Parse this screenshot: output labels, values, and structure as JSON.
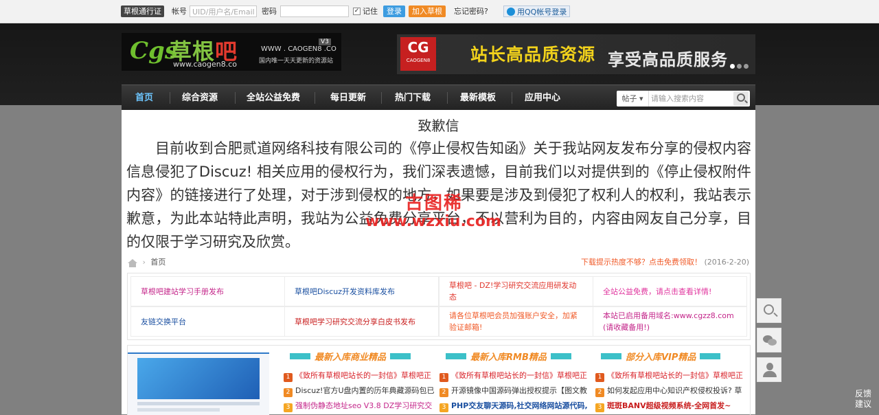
{
  "login_bar": {
    "passport_label": "草根通行证",
    "account_label": "帐号",
    "account_placeholder": "UID/用户名/Email",
    "password_label": "密码",
    "remember_label": "记住",
    "login_button": "登录",
    "join_button": "加入草根",
    "forgot_link": "忘记密码?",
    "qq_login": "用QQ帐号登录"
  },
  "logo": {
    "mark": "Cgs",
    "name_part1": "草根",
    "name_part2": "吧",
    "url": "www.caogen8.co",
    "tag_url": "WWW . CAOGEN8 .CO",
    "version": "V3",
    "slogan": "国内唯一天天更新的资源站"
  },
  "banner": {
    "badge_big": "CG",
    "badge_small": "CAOGEN8",
    "text1": "站长高品质资源",
    "text2": "享受高品质服务",
    "accent_color": "#f2d21b"
  },
  "nav": {
    "items": [
      "首页",
      "综合资源",
      "全站公益免费",
      "每日更新",
      "热门下载",
      "最新模板",
      "应用中心"
    ],
    "search_type": "帖子",
    "search_placeholder": "请输入搜索内容"
  },
  "apology": {
    "title": "致歉信",
    "body": "目前收到合肥贰道网络科技有限公司的《停止侵权告知函》关于我站网友发布分享的侵权内容信息侵犯了Discuz! 相关应用的侵权行为，我们深表遗憾，目前我们以对提供到的《停止侵权附件内容》的链接进行了处理，对于涉到侵权的地方，如果要是涉及到侵犯了权利人的权利，我站表示歉意，为此本站特此声明，我站为公益免费分享平台，不以营利为目的，内容由网友自己分享，目的仅限于学习研究及欣赏。"
  },
  "watermark": {
    "line1": "古图稀",
    "line2": "www.wzxiu.com"
  },
  "breadcrumb": {
    "home": "首页",
    "notice": "下载提示热度不够？点击免费领取！",
    "date": "(2016-2-20)"
  },
  "link_grid": [
    {
      "text": "草根吧建站学习手册发布",
      "color": "#c4268a"
    },
    {
      "text": "草根吧Discuz开发资料库发布",
      "color": "#1a4fa0"
    },
    {
      "text": "草根吧 - DZ!学习研究交流应用研发动态",
      "color": "#e0352b"
    },
    {
      "text": "全站公益免费，请点击查看详情!",
      "color": "#e0359e"
    },
    {
      "text": "友链交换平台",
      "color": "#1a4fa0"
    },
    {
      "text": "草根吧学习研究交流分享白皮书发布",
      "color": "#c81e1e"
    },
    {
      "text": "请各位草根吧会员加强账户安全，加紧验证邮箱!",
      "color": "#f05a28"
    },
    {
      "text": "本站已启用备用域名:www.cgzz8.com (请收藏备用!)",
      "color": "#c4268a"
    }
  ],
  "columns": [
    {
      "heading": "最新入库商业精品",
      "rows": [
        {
          "num": "1",
          "text": "《致所有草根吧站长的一封信》草根吧正",
          "color": "#d8232a",
          "num_color": "#e05a1e"
        },
        {
          "num": "2",
          "text": "Discuz!官方U盘内置的历年典藏源码包已",
          "color": "#333333",
          "num_color": "#f08a24"
        },
        {
          "num": "3",
          "text": "强制伪静态地址seo V3.8 DZ学习研究交",
          "color": "#c4268a",
          "num_color": "#f5a623"
        }
      ]
    },
    {
      "heading": "最新入库RMB精品",
      "rows": [
        {
          "num": "1",
          "text": "《致所有草根吧站长的一封信》草根吧正",
          "color": "#d8232a",
          "num_color": "#e05a1e"
        },
        {
          "num": "2",
          "text": "开源镜像中国源码弹出授权提示【图文教",
          "color": "#333333",
          "num_color": "#f08a24"
        },
        {
          "num": "3",
          "text": "PHP交友聊天源码,社交网络网站源代码,",
          "color": "#1a4fa0",
          "num_color": "#f5a623"
        }
      ]
    },
    {
      "heading": "部分入库VIP精品",
      "rows": [
        {
          "num": "1",
          "text": "《致所有草根吧站长的一封信》草根吧正",
          "color": "#d8232a",
          "num_color": "#e05a1e"
        },
        {
          "num": "2",
          "text": "如何发起应用中心知识产权侵权投诉? 草",
          "color": "#333333",
          "num_color": "#f08a24"
        },
        {
          "num": "3",
          "text": "斑斑BANV超级视频系统-全网首发~",
          "color": "#c81e1e",
          "num_color": "#f5a623"
        }
      ]
    }
  ],
  "feedback": "反馈建议"
}
